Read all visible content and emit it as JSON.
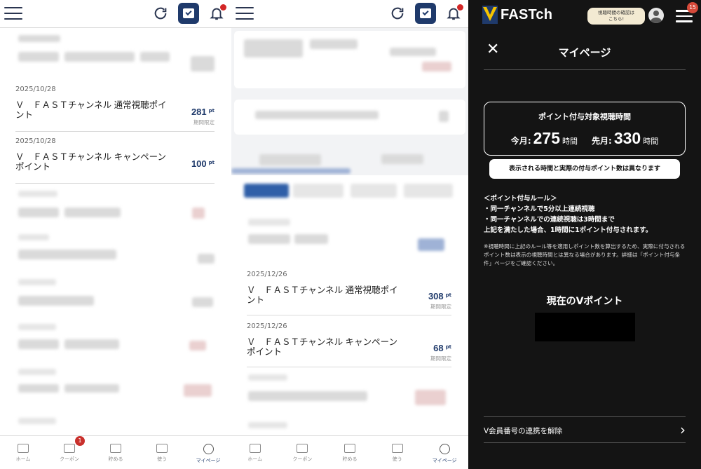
{
  "panel1": {
    "transactions": [
      {
        "date": "2025/10/28",
        "title": "Ｖ　ＦＡＳＴチャンネル 通常視聴ポイント",
        "points": "281",
        "unit": "pt",
        "limit": "期間限定"
      },
      {
        "date": "2025/10/28",
        "title": "Ｖ　ＦＡＳＴチャンネル キャンペーンポイント",
        "points": "100",
        "unit": "pt",
        "limit": ""
      }
    ]
  },
  "panel2": {
    "transactions": [
      {
        "date": "2025/12/26",
        "title": "Ｖ　ＦＡＳＴチャンネル 通常視聴ポイント",
        "points": "308",
        "unit": "pt",
        "limit": "期間限定"
      },
      {
        "date": "2025/12/26",
        "title": "Ｖ　ＦＡＳＴチャンネル キャンペーンポイント",
        "points": "68",
        "unit": "pt",
        "limit": "期間限定"
      }
    ]
  },
  "bottom_nav": {
    "items": [
      {
        "label": "ホーム",
        "icon": "home-icon"
      },
      {
        "label": "クーポン",
        "icon": "coupon-icon"
      },
      {
        "label": "貯める",
        "icon": "earn-icon"
      },
      {
        "label": "使う",
        "icon": "use-icon"
      },
      {
        "label": "マイページ",
        "icon": "mypage-icon"
      }
    ],
    "coupon_badge": "1"
  },
  "panel3": {
    "logo_text": "FASTch",
    "tooltip": "視聴時間の確認は\nこちら!",
    "menu_badge": "15",
    "page_title": "マイページ",
    "hours_box": {
      "title": "ポイント付与対象視聴時間",
      "this_month_label": "今月",
      "this_month_value": "275",
      "last_month_label": "先月",
      "last_month_value": "330",
      "unit": "時間"
    },
    "note": "表示される時間と実際の付与ポイント数は異なります",
    "rules": [
      "＜ポイント付与ルール＞",
      "・同一チャンネルで5分以上連続視聴",
      "・同一チャンネルでの連続視聴は3時間まで",
      "上記を満たした場合、1時間に1ポイント付与されます。"
    ],
    "fine_print": "※視聴時間に上記のルール等を適用しポイント数を算出するため、実際に付与されるポイント数は表示の視聴時間とは異なる場合があります。詳細は「ポイント付与条件」ページをご確認ください。",
    "current_points_label": "現在のVポイント",
    "unlink_label": "V会員番号の連携を解除"
  },
  "colors": {
    "accent": "#1f3a6b",
    "badge": "#c9302c",
    "dark_bg": "#141414"
  }
}
